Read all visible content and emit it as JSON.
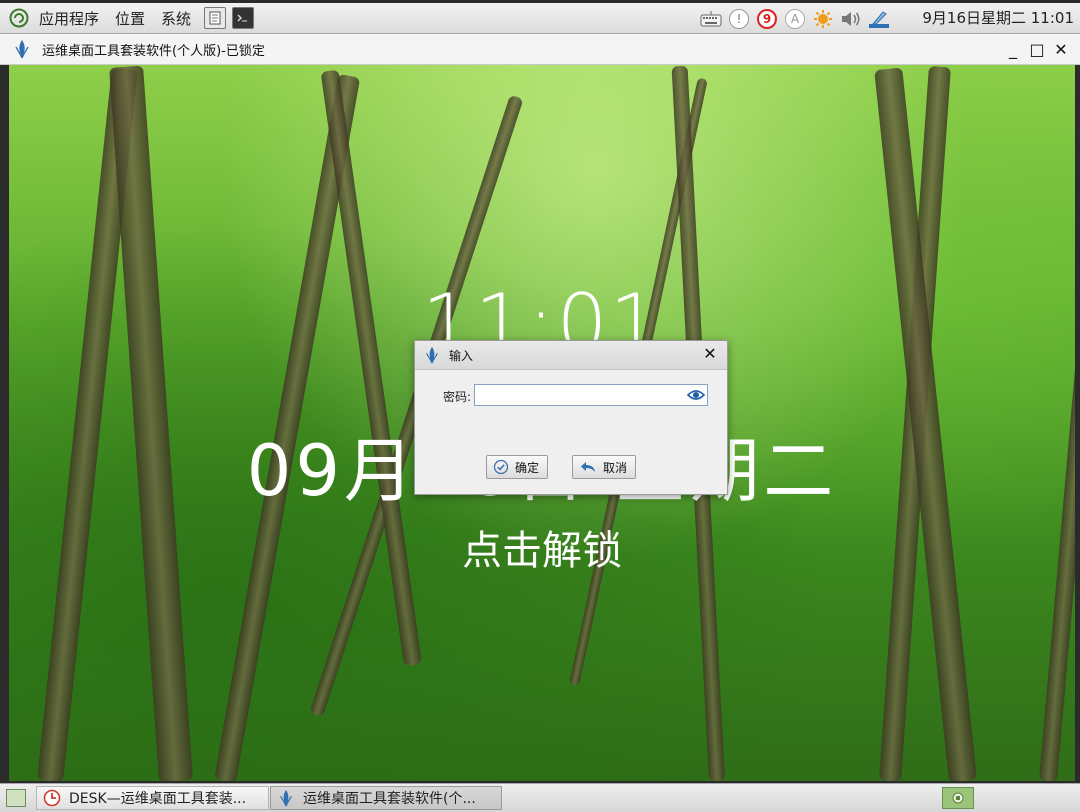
{
  "top_panel": {
    "menus": [
      "应用程序",
      "位置",
      "系统"
    ],
    "tray_badge_number": "9",
    "tray_letter": "A",
    "clock": "9月16日星期二 11:01"
  },
  "window": {
    "title": "运维桌面工具套装软件(个人版)-已锁定",
    "controls": {
      "minimize": "_",
      "maximize": "□",
      "close": "✕"
    }
  },
  "lock_screen": {
    "time": "11:01",
    "date": "09月16日 星期二",
    "hint": "点击解锁"
  },
  "dialog": {
    "title": "输入",
    "password_label": "密码:",
    "password_value": "",
    "ok_label": "确定",
    "cancel_label": "取消",
    "close_glyph": "✕"
  },
  "taskbar": {
    "tasks": [
      {
        "label": "DESK—运维桌面工具套装..."
      },
      {
        "label": "运维桌面工具套装软件(个..."
      }
    ]
  },
  "colors": {
    "badge_red": "#e02020",
    "accent_blue": "#2f6fb3",
    "sun_orange": "#f29a1a"
  }
}
